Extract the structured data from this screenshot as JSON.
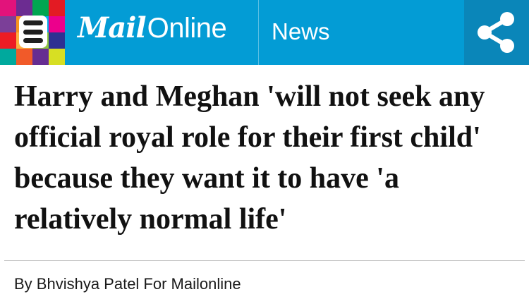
{
  "header": {
    "brand_mail": "Mail",
    "brand_online": "Online",
    "section": "News",
    "menu_icon": "hamburger-menu-icon",
    "share_icon": "share-icon",
    "colors": {
      "bar": "#039cd5",
      "share_box": "#0a86b9",
      "mosaic": [
        "#e2137b",
        "#6c2c91",
        "#00a651",
        "#e31b23",
        "#7b3f98",
        "#f7941d",
        "#00aeef",
        "#ec008c",
        "#ed1c24",
        "#fcb040",
        "#8dc63f",
        "#2e3192",
        "#00a99d",
        "#f15a29",
        "#662d91",
        "#d7df23"
      ]
    }
  },
  "article": {
    "headline": "Harry and Meghan 'will not seek any official royal role for their first child' because they want it to have 'a relatively normal life'",
    "byline": "By Bhvishya Patel For Mailonline"
  }
}
